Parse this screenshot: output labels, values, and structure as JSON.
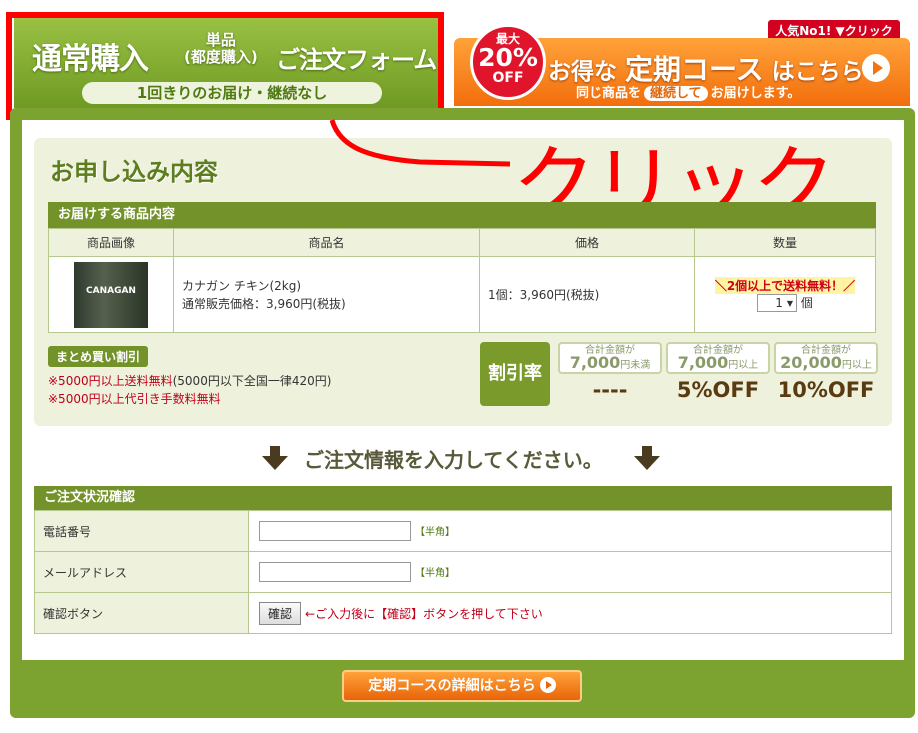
{
  "tabs": {
    "normal_title": "通常購入",
    "normal_small": "単品\n都度購入",
    "normal_form": "ご注文フォーム",
    "normal_sub": "1回きりのお届け・継続なし",
    "teiki_badge_top": "最大",
    "teiki_badge_pct": "20%",
    "teiki_badge_off": "OFF",
    "teiki_title_a": "お得な",
    "teiki_title_b": "定期コース",
    "teiki_title_c": "はこちら",
    "teiki_sub_a": "同じ商品を",
    "teiki_sub_b": "継続して",
    "teiki_sub_c": "お届けします。",
    "ninki": "人気No1! ▼クリック"
  },
  "annotation": {
    "text": "クリック"
  },
  "section_title": "お申し込み内容",
  "product": {
    "header": "お届けする商品内容",
    "col_image": "商品画像",
    "col_name": "商品名",
    "col_price": "価格",
    "col_qty": "数量",
    "image_label": "CANAGAN",
    "name": "カナガン チキン(2kg)",
    "regular_price": "通常販売価格：3,960円(税抜)",
    "price": "1個：3,960円(税抜)",
    "free_ship": "＼2個以上で送料無料！／",
    "qty_value": "1",
    "qty_unit": "個"
  },
  "bulk": {
    "label": "まとめ買い割引",
    "note1_red": "※5000円以上送料無料",
    "note1_rest": "(5000円以下全国一律420円)",
    "note2": "※5000円以上代引き手数料無料",
    "rate": "割引率",
    "tiers": [
      {
        "l1": "合計金額が",
        "amt": "7,000",
        "unit": "円未満",
        "off": "----"
      },
      {
        "l1": "合計金額が",
        "amt": "7,000",
        "unit": "円以上",
        "off": "5%OFF"
      },
      {
        "l1": "合計金額が",
        "amt": "20,000",
        "unit": "円以上",
        "off": "10%OFF"
      }
    ]
  },
  "order_prompt": "ご注文情報を入力してください。",
  "form": {
    "header": "ご注文状況確認",
    "phone_label": "電話番号",
    "email_label": "メールアドレス",
    "hankaku": "【半角】",
    "confirm_label": "確認ボタン",
    "confirm_btn": "確認",
    "confirm_note": "←ご入力後に【確認】ボタンを押して下さい"
  },
  "teiki_button": "定期コースの詳細はこちら"
}
